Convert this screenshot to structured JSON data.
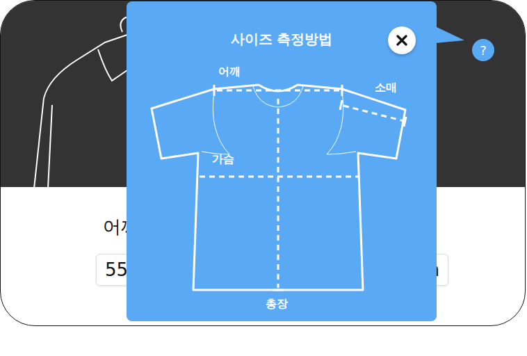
{
  "background": {
    "label": "어깨",
    "input": {
      "value": "55",
      "unit": "cm"
    }
  },
  "help_button": {
    "label": "?"
  },
  "popup": {
    "title": "사이즈 측정방법",
    "labels": {
      "shoulder": "어깨",
      "sleeve": "소매",
      "chest": "가슴",
      "length": "총장"
    }
  }
}
